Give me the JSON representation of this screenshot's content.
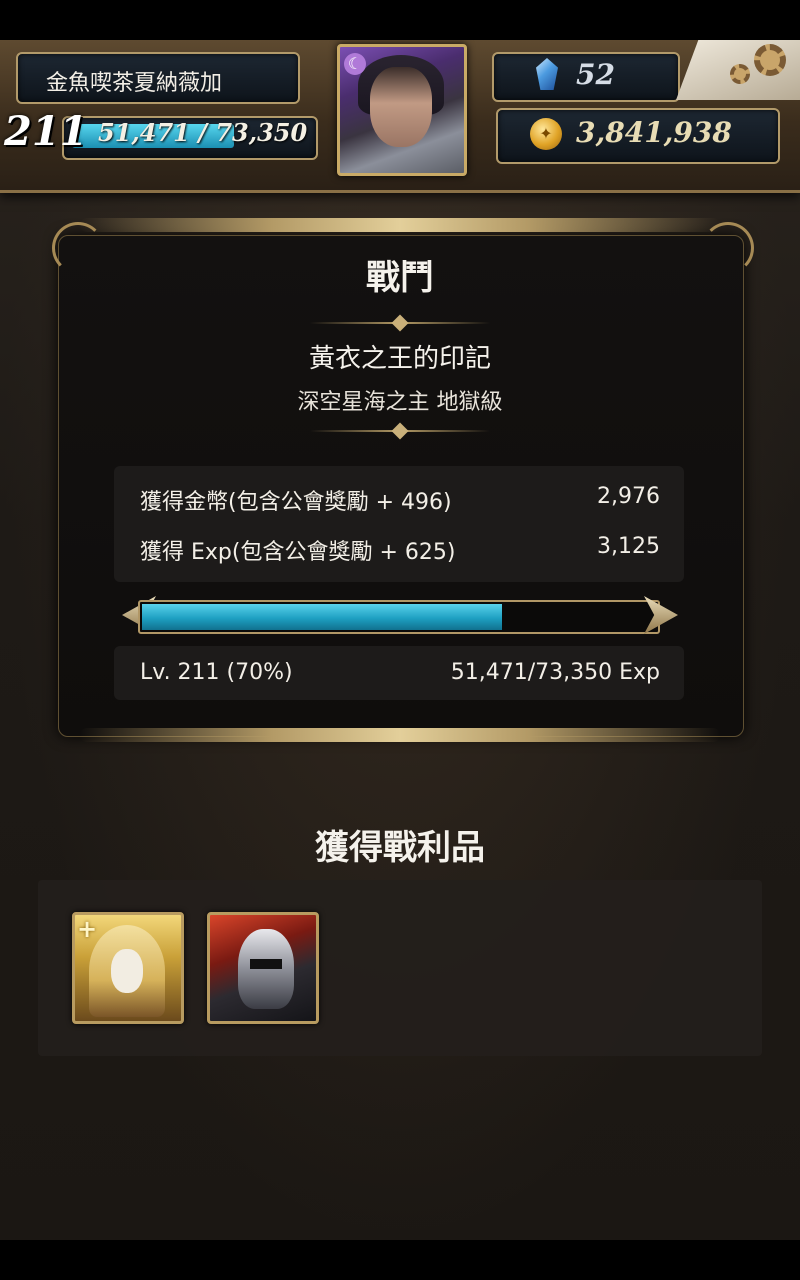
{
  "header": {
    "player_name": "金魚喫茶夏納薇加",
    "level": "211",
    "exp_text": "51,471 / 73,350",
    "exp_fraction": 0.7,
    "gems": "52",
    "gold": "3,841,938",
    "exp_bar_color": "#2fb3d3"
  },
  "battle": {
    "title": "戰鬥",
    "quest_name": "黃衣之王的印記",
    "quest_subtitle": "深空星海之主 地獄級",
    "rewards": [
      {
        "label": "獲得金幣(包含公會獎勵 + 496)",
        "value": "2,976"
      },
      {
        "label": "獲得 Exp(包含公會獎勵 + 625)",
        "value": "3,125"
      }
    ],
    "progress_fraction": 0.7,
    "level_label": "Lv. 211 (70%)",
    "exp_label": "51,471/73,350 Exp"
  },
  "loot": {
    "title": "獲得戰利品",
    "items": [
      {
        "icon": "hooded-masked-figure-card"
      },
      {
        "icon": "armored-knight-card"
      }
    ]
  },
  "icons": {
    "gem": "blue-crystal-icon",
    "gold": "gold-coin-icon",
    "settings": "gears-icon",
    "moon": "crescent-moon-badge"
  }
}
